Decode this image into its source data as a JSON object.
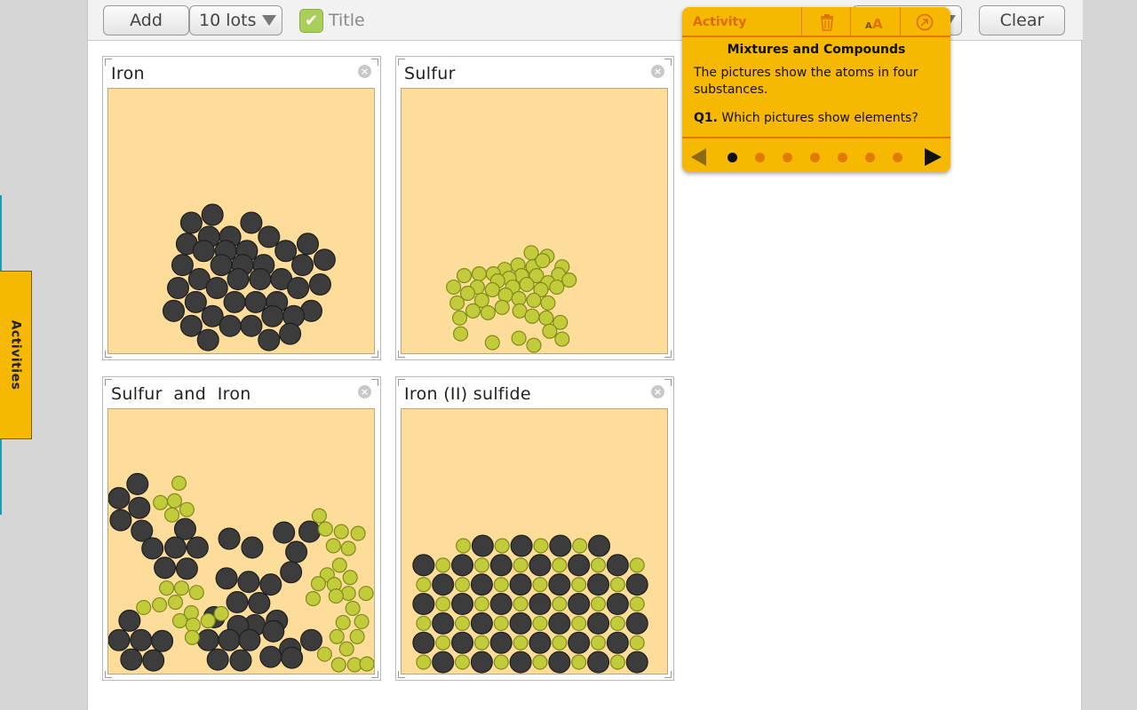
{
  "sidebar": {
    "activities_label": "Activities"
  },
  "toolbar": {
    "add_label": "Add",
    "lots_value": "10 lots",
    "title_checked": true,
    "title_label": "Title",
    "clear_label": "Clear"
  },
  "panels": [
    {
      "title": "Iron",
      "close_glyph": "×"
    },
    {
      "title": "Sulfur",
      "close_glyph": "×"
    },
    {
      "title": "Sulfur  and  Iron",
      "close_glyph": "×"
    },
    {
      "title": "Iron (II) sulfide",
      "close_glyph": "×"
    }
  ],
  "activity": {
    "label": "Activity",
    "title": "Mixtures and Compounds",
    "text": "The pictures show the atoms in four substances.",
    "question_number": "Q1.",
    "question": "Which pictures show elements?",
    "dot_count": 7,
    "current_dot": 0
  },
  "colors": {
    "iron_atom": "#3c3c3c",
    "sulfur_atom": "#c2cc3a",
    "container_fill": "#fedd9a",
    "activity_bg": "#f6b800",
    "activity_accent": "#e07b00"
  }
}
